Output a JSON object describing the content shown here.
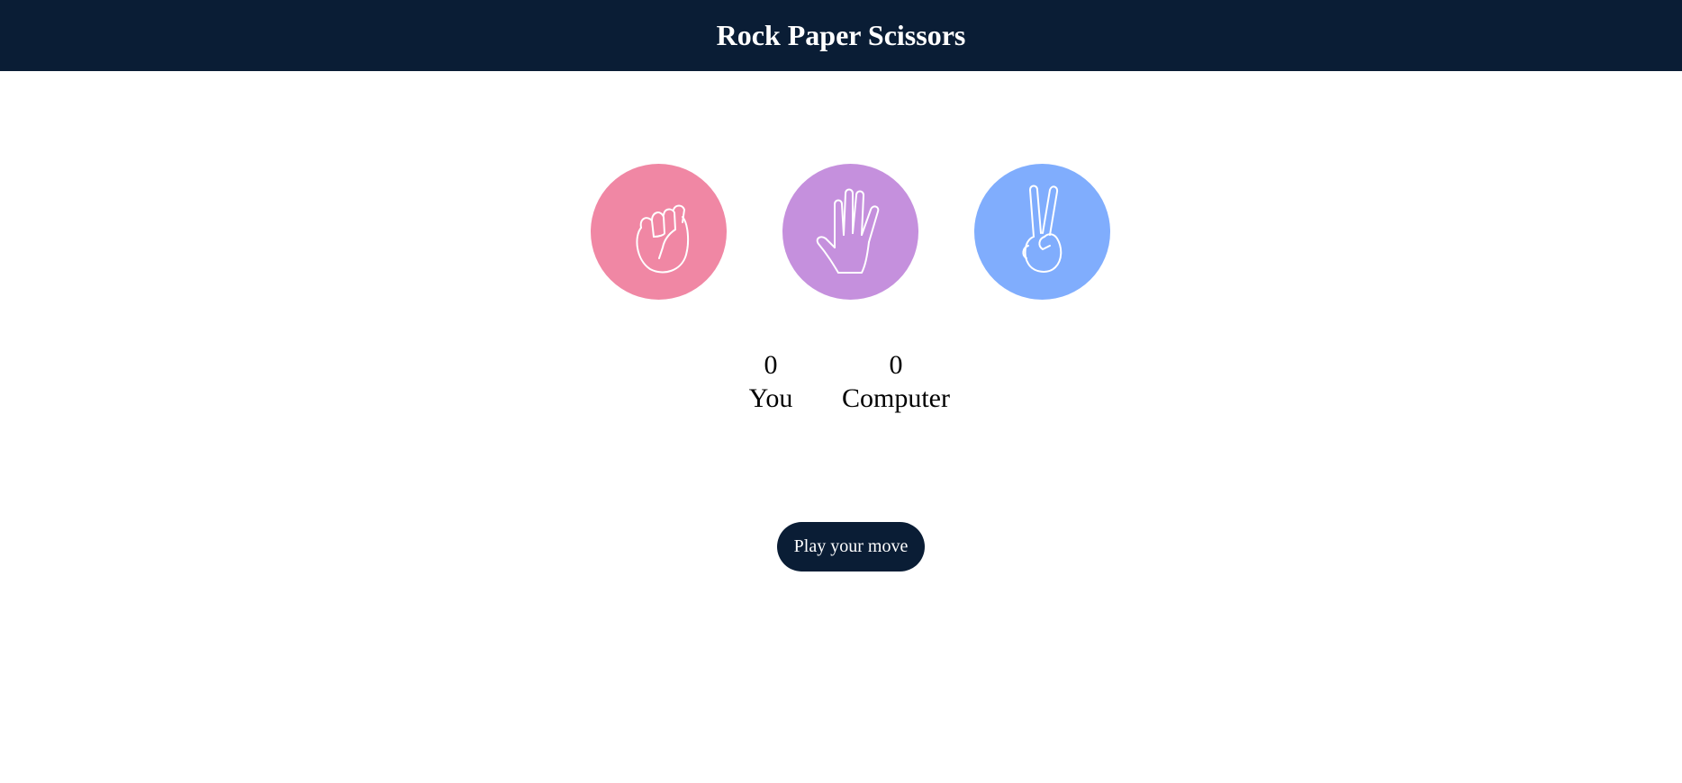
{
  "header": {
    "title": "Rock Paper Scissors"
  },
  "choices": [
    {
      "id": "rock",
      "icon": "rock-fist-icon",
      "color": "#f087a4"
    },
    {
      "id": "paper",
      "icon": "paper-hand-icon",
      "color": "#c590dd"
    },
    {
      "id": "scissors",
      "icon": "scissors-hand-icon",
      "color": "#80adfd"
    }
  ],
  "score": {
    "user": {
      "value": "0",
      "label": "You"
    },
    "computer": {
      "value": "0",
      "label": "Computer"
    }
  },
  "play_button": {
    "label": "Play your move"
  },
  "colors": {
    "navy": "#0a1d35",
    "white": "#ffffff"
  }
}
